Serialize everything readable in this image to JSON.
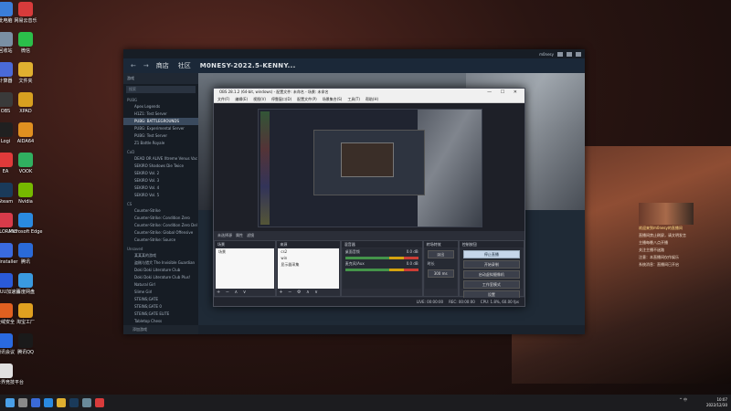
{
  "desktop": {
    "icons": [
      {
        "label": "此电脑"
      },
      {
        "label": "网易云音乐"
      },
      {
        "label": "回收站"
      },
      {
        "label": "微信"
      },
      {
        "label": "计算器"
      },
      {
        "label": "文件夹"
      },
      {
        "label": "OBS"
      },
      {
        "label": "XPAD"
      },
      {
        "label": "Logi"
      },
      {
        "label": "AIDA64"
      },
      {
        "label": "EA"
      },
      {
        "label": "VOOK"
      },
      {
        "label": "Steam"
      },
      {
        "label": "Nvidia"
      },
      {
        "label": "VALORANT"
      },
      {
        "label": "Microsoft Edge"
      },
      {
        "label": "Uninstaller"
      },
      {
        "label": "腾讯"
      },
      {
        "label": "网易UU加速器"
      },
      {
        "label": "百度网盘"
      },
      {
        "label": "火绒安全"
      },
      {
        "label": "淘宝工厂"
      },
      {
        "label": "腾讯会议"
      },
      {
        "label": "腾讯QQ"
      },
      {
        "label": "完美世界竞技平台"
      }
    ]
  },
  "steam": {
    "nav": {
      "back": "←",
      "forward": "→",
      "store": "商店",
      "community": "社区",
      "title": "M0NESY-2022.5-KENNY..."
    },
    "account": "m0nesy",
    "library": {
      "header": "游戏",
      "search": "搜索",
      "groups": [
        {
          "name": "PUBG",
          "items": [
            "Apex Legends",
            "H1Z1: Test Server",
            "PUBG: BATTLEGROUNDS",
            "PUBG: Experimental Server",
            "PUBG: Test Server",
            "Z1 Battle Royale"
          ]
        },
        {
          "name": "CoD",
          "items": [
            "DEAD OR ALIVE Xtreme Venus Vac",
            "SEKIRO Shadows Die Twice",
            "SEKIRO Vol. 2",
            "SEKIRO Vol. 3",
            "SEKIRO Vol. 4",
            "SEKIRO Vol. 5"
          ]
        },
        {
          "name": "CS",
          "items": [
            "Counter-Strike",
            "Counter-Strike: Condition Zero",
            "Counter-Strike: Condition Zero Del",
            "Counter-Strike: Global Offensive",
            "Counter-Strike: Source"
          ]
        },
        {
          "name": "Unsaved",
          "items": [
            "某某某的游戏",
            "盗贼与猎犬 The Invisible Guardian",
            "Doki Doki Literature Club",
            "Doki Doki Literature Club Plus!",
            "Natural Girl",
            "Slime Girl",
            "STEINS;GATE",
            "STEINS;GATE 0",
            "STEINS;GATE ELITE",
            "Tabletop Chess"
          ]
        }
      ],
      "bottom": "添加游戏"
    }
  },
  "obs": {
    "title": "OBS 28.1.2 (64-bit, windows) - 配置文件: 未命名 - 场景: 未命名",
    "window_controls": "— ☐ ✕",
    "menu": [
      "文件(F)",
      "编辑(E)",
      "视图(V)",
      "停靠窗口(D)",
      "配置文件(P)",
      "场景集合(S)",
      "工具(T)",
      "帮助(H)"
    ],
    "tabs": {
      "scene_label": "未选择源",
      "props": "属性",
      "filters": "滤镜"
    },
    "panels": {
      "scenes": {
        "title": "场景",
        "items": [
          "场景"
        ],
        "footer": "+ − ∧ ∨"
      },
      "sources": {
        "title": "来源",
        "items": [
          "cs2",
          "win",
          "显示器采集"
        ],
        "footer": "+ − ⚙ ∧ ∨"
      },
      "mixer": {
        "title": "混音器",
        "tracks": [
          {
            "name": "桌面音频",
            "db": "0.0 dB"
          },
          {
            "name": "麦克风/Aux",
            "db": "0.0 dB"
          }
        ]
      },
      "transitions": {
        "title": "转场特效",
        "type": "淡出",
        "duration_label": "时长",
        "duration": "300 ms"
      },
      "controls": {
        "title": "控制按钮",
        "buttons": [
          "停止直播",
          "开始录制",
          "启动虚拟摄像机",
          "工作室模式",
          "设置",
          "退出"
        ]
      }
    },
    "status": {
      "live": "LIVE: 00:00:00",
      "rec": "REC: 00:00:00",
      "cpu": "CPU: 1.8%, 60.00 fps"
    }
  },
  "chat": {
    "lines": [
      {
        "text": "欢迎来到m0nesy的直播间",
        "highlight": true
      },
      {
        "text": "直播间禁止刷屏，请文明发言",
        "highlight": false
      },
      {
        "text": "主播每晚八点开播",
        "highlight": false
      },
      {
        "text": "关注主播不迷路",
        "highlight": false
      },
      {
        "text": "注意：本直播间仅作娱乐",
        "highlight": false
      },
      {
        "text": "系统消息：直播间已开启",
        "highlight": false
      }
    ]
  },
  "taskbar": {
    "tray": "^ 中",
    "time": "10:07",
    "date": "2022/12/30"
  }
}
